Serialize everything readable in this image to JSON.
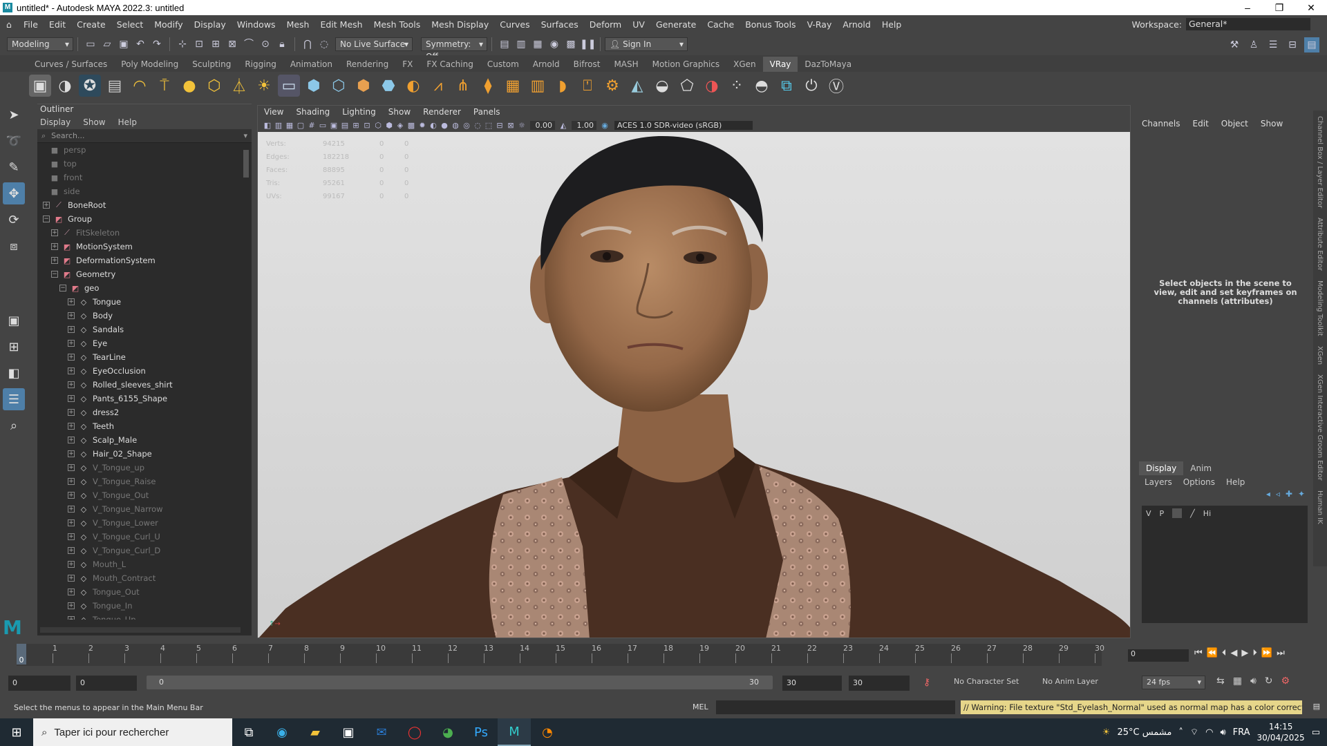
{
  "window": {
    "title": "untitled* - Autodesk MAYA 2022.3: untitled"
  },
  "menubar": {
    "items": [
      "File",
      "Edit",
      "Create",
      "Select",
      "Modify",
      "Display",
      "Windows",
      "Mesh",
      "Edit Mesh",
      "Mesh Tools",
      "Mesh Display",
      "Curves",
      "Surfaces",
      "Deform",
      "UV",
      "Generate",
      "Cache",
      "Bonus Tools",
      "V-Ray",
      "Arnold",
      "Help"
    ],
    "workspace_label": "Workspace:",
    "workspace_value": "General*"
  },
  "statusline": {
    "mode": "Modeling",
    "live_surface": "No Live Surface",
    "symmetry": "Symmetry: Off",
    "sign_in": "Sign In"
  },
  "shelf": {
    "tabs": [
      "Curves / Surfaces",
      "Poly Modeling",
      "Sculpting",
      "Rigging",
      "Animation",
      "Rendering",
      "FX",
      "FX Caching",
      "Custom",
      "Arnold",
      "Bifrost",
      "MASH",
      "Motion Graphics",
      "XGen",
      "VRay",
      "DazToMaya"
    ],
    "active_tab": "VRay"
  },
  "outliner": {
    "title": "Outliner",
    "menus": [
      "Display",
      "Show",
      "Help"
    ],
    "search_placeholder": "Search...",
    "rows": [
      {
        "label": "persp",
        "indent": 0,
        "type": "camera",
        "dim": true
      },
      {
        "label": "top",
        "indent": 0,
        "type": "camera",
        "dim": true
      },
      {
        "label": "front",
        "indent": 0,
        "type": "camera",
        "dim": true
      },
      {
        "label": "side",
        "indent": 0,
        "type": "camera",
        "dim": true
      },
      {
        "label": "BoneRoot",
        "indent": 0,
        "type": "joint",
        "expand": "+"
      },
      {
        "label": "Group",
        "indent": 0,
        "type": "group",
        "expand": "−"
      },
      {
        "label": "FitSkeleton",
        "indent": 1,
        "type": "joint",
        "expand": "+",
        "dim": true
      },
      {
        "label": "MotionSystem",
        "indent": 1,
        "type": "group",
        "expand": "+"
      },
      {
        "label": "DeformationSystem",
        "indent": 1,
        "type": "group",
        "expand": "+"
      },
      {
        "label": "Geometry",
        "indent": 1,
        "type": "group",
        "expand": "−"
      },
      {
        "label": "geo",
        "indent": 2,
        "type": "group",
        "expand": "−"
      },
      {
        "label": "Tongue",
        "indent": 3,
        "type": "shape",
        "expand": "+"
      },
      {
        "label": "Body",
        "indent": 3,
        "type": "shape",
        "expand": "+"
      },
      {
        "label": "Sandals",
        "indent": 3,
        "type": "shape",
        "expand": "+"
      },
      {
        "label": "Eye",
        "indent": 3,
        "type": "shape",
        "expand": "+"
      },
      {
        "label": "TearLine",
        "indent": 3,
        "type": "shape",
        "expand": "+"
      },
      {
        "label": "EyeOcclusion",
        "indent": 3,
        "type": "shape",
        "expand": "+"
      },
      {
        "label": "Rolled_sleeves_shirt",
        "indent": 3,
        "type": "shape",
        "expand": "+"
      },
      {
        "label": "Pants_6155_Shape",
        "indent": 3,
        "type": "shape",
        "expand": "+"
      },
      {
        "label": "dress2",
        "indent": 3,
        "type": "shape",
        "expand": "+"
      },
      {
        "label": "Teeth",
        "indent": 3,
        "type": "shape",
        "expand": "+"
      },
      {
        "label": "Scalp_Male",
        "indent": 3,
        "type": "shape",
        "expand": "+"
      },
      {
        "label": "Hair_02_Shape",
        "indent": 3,
        "type": "shape",
        "expand": "+"
      },
      {
        "label": "V_Tongue_up",
        "indent": 3,
        "type": "shape",
        "expand": "+",
        "dim": true
      },
      {
        "label": "V_Tongue_Raise",
        "indent": 3,
        "type": "shape",
        "expand": "+",
        "dim": true
      },
      {
        "label": "V_Tongue_Out",
        "indent": 3,
        "type": "shape",
        "expand": "+",
        "dim": true
      },
      {
        "label": "V_Tongue_Narrow",
        "indent": 3,
        "type": "shape",
        "expand": "+",
        "dim": true
      },
      {
        "label": "V_Tongue_Lower",
        "indent": 3,
        "type": "shape",
        "expand": "+",
        "dim": true
      },
      {
        "label": "V_Tongue_Curl_U",
        "indent": 3,
        "type": "shape",
        "expand": "+",
        "dim": true
      },
      {
        "label": "V_Tongue_Curl_D",
        "indent": 3,
        "type": "shape",
        "expand": "+",
        "dim": true
      },
      {
        "label": "Mouth_L",
        "indent": 3,
        "type": "shape",
        "expand": "+",
        "dim": true
      },
      {
        "label": "Mouth_Contract",
        "indent": 3,
        "type": "shape",
        "expand": "+",
        "dim": true
      },
      {
        "label": "Tongue_Out",
        "indent": 3,
        "type": "shape",
        "expand": "+",
        "dim": true
      },
      {
        "label": "Tongue_In",
        "indent": 3,
        "type": "shape",
        "expand": "+",
        "dim": true
      },
      {
        "label": "Tongue_Up",
        "indent": 3,
        "type": "shape",
        "expand": "+",
        "dim": true
      }
    ]
  },
  "viewport": {
    "menus": [
      "View",
      "Shading",
      "Lighting",
      "Show",
      "Renderer",
      "Panels"
    ],
    "exposure": "0.00",
    "gamma": "1.00",
    "color_space": "ACES 1.0 SDR-video (sRGB)",
    "hud": [
      [
        "Verts:",
        "94215",
        "0",
        "0"
      ],
      [
        "Edges:",
        "182218",
        "0",
        "0"
      ],
      [
        "Faces:",
        "88895",
        "0",
        "0"
      ],
      [
        "Tris:",
        "95261",
        "0",
        "0"
      ],
      [
        "UVs:",
        "99167",
        "0",
        "0"
      ]
    ]
  },
  "channelbox": {
    "menus": [
      "Channels",
      "Edit",
      "Object",
      "Show"
    ],
    "message": "Select objects in the scene to view, edit and set keyframes on channels (attributes)"
  },
  "layereditor": {
    "tabs": [
      "Display",
      "Anim"
    ],
    "active_tab": "Display",
    "menus": [
      "Layers",
      "Options",
      "Help"
    ],
    "columns": [
      "V",
      "P",
      "Hi"
    ]
  },
  "sidetabs": [
    "Channel Box / Layer Editor",
    "Attribute Editor",
    "Modeling Toolkit",
    "XGen",
    "XGen Interactive Groom Editor",
    "Human IK"
  ],
  "timeslider": {
    "ticks": [
      "0",
      "1",
      "2",
      "3",
      "4",
      "5",
      "6",
      "7",
      "8",
      "9",
      "10",
      "11",
      "12",
      "13",
      "14",
      "15",
      "16",
      "17",
      "18",
      "19",
      "20",
      "21",
      "22",
      "23",
      "24",
      "25",
      "26",
      "27",
      "28",
      "29",
      "30"
    ],
    "current_frame": "0",
    "frame_field": "0"
  },
  "rangeslider": {
    "start": "0",
    "anim_start": "0",
    "range_start": "0",
    "range_end": "30",
    "anim_end": "30",
    "end": "30",
    "character_set": "No Character Set",
    "anim_layer": "No Anim Layer",
    "fps": "24 fps"
  },
  "cmdline": {
    "help_text": "Select the menus to appear in the Main Menu Bar",
    "lang": "MEL",
    "warning": "// Warning: File texture \"Std_Eyelash_Normal\" used as normal map has a color correction enable"
  },
  "taskbar": {
    "search_placeholder": "Taper ici pour rechercher",
    "weather": "25°C مشمس",
    "lang": "FRA",
    "time": "14:15",
    "date": "30/04/2025"
  }
}
